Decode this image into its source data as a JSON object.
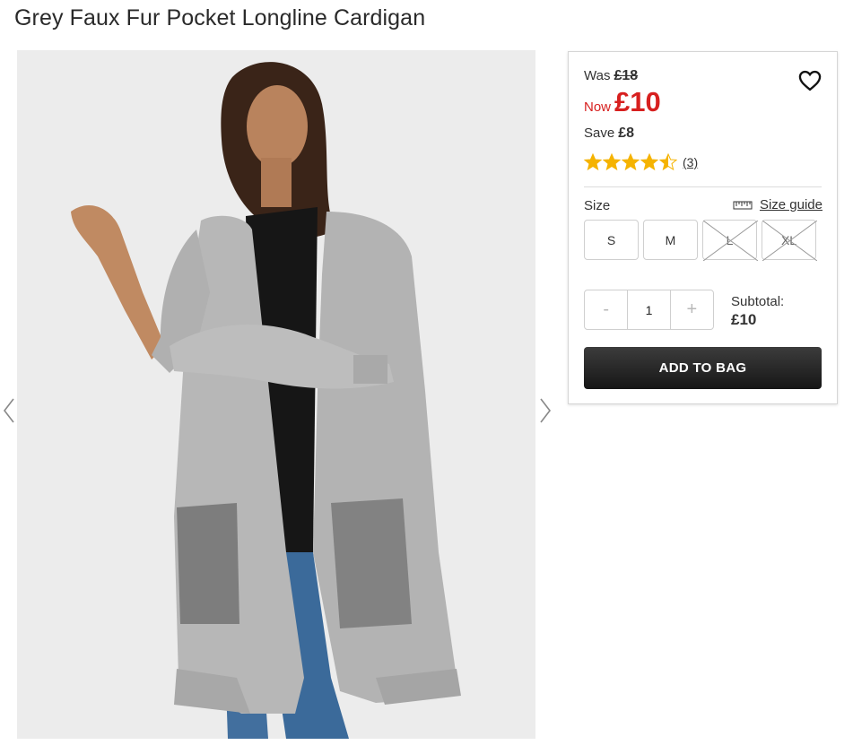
{
  "product": {
    "title": "Grey Faux Fur Pocket Longline Cardigan"
  },
  "gallery": {
    "prev_icon": "chevron-left-icon",
    "next_icon": "chevron-right-icon"
  },
  "pricing": {
    "was_label": "Was",
    "was_price": "£18",
    "now_label": "Now",
    "now_price": "£10",
    "save_label": "Save",
    "save_amount": "£8",
    "accent_color": "#d7201f"
  },
  "rating": {
    "stars": 4.5,
    "max": 5,
    "count": "(3)",
    "star_color": "#f5b301"
  },
  "wishlist": {
    "icon": "heart-icon"
  },
  "sizes": {
    "label": "Size",
    "guide_label": "Size guide",
    "guide_icon": "ruler-icon",
    "options": [
      {
        "label": "S",
        "available": true
      },
      {
        "label": "M",
        "available": true
      },
      {
        "label": "L",
        "available": false
      },
      {
        "label": "XL",
        "available": false
      }
    ]
  },
  "quantity": {
    "minus": "-",
    "value": "1",
    "plus": "+"
  },
  "subtotal": {
    "label": "Subtotal:",
    "amount": "£10"
  },
  "cta": {
    "label": "ADD TO BAG"
  }
}
